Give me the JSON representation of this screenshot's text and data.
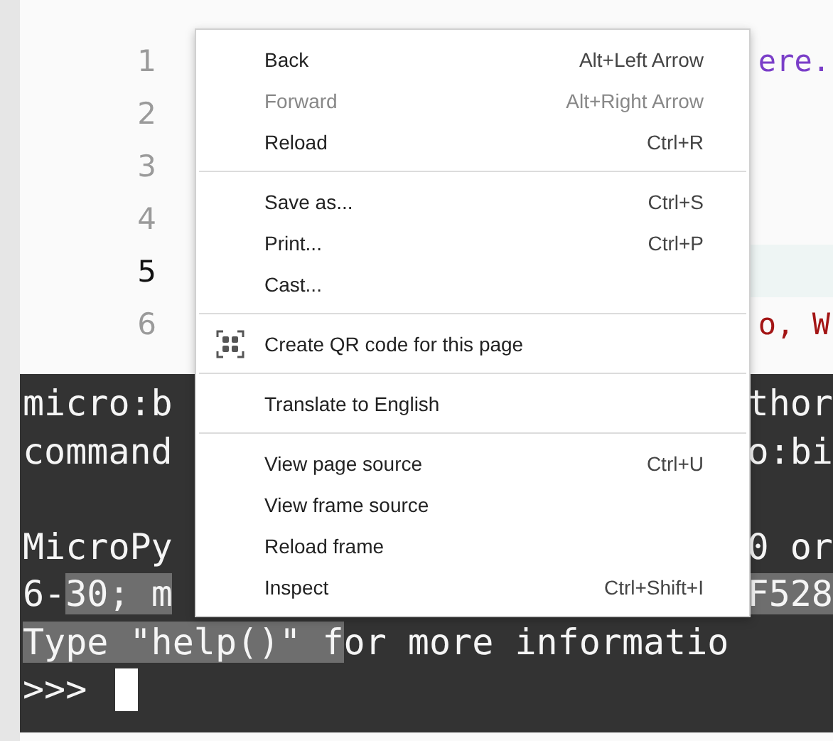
{
  "editor": {
    "lines": [
      {
        "number": "1",
        "current": false,
        "code": "ere.",
        "color": "#7a3ec8"
      },
      {
        "number": "2",
        "current": false
      },
      {
        "number": "3",
        "current": false
      },
      {
        "number": "4",
        "current": false
      },
      {
        "number": "5",
        "current": true
      },
      {
        "number": "6",
        "current": false,
        "code": "o, W",
        "color": "#a31515"
      }
    ]
  },
  "console": {
    "lines": [
      {
        "kind": "text",
        "left": [
          {
            "text": "micro:b",
            "selected": false
          }
        ],
        "right": [
          {
            "text": "thor",
            "selected": false
          }
        ]
      },
      {
        "kind": "text",
        "left": [
          {
            "text": "command",
            "selected": false
          }
        ],
        "right": [
          {
            "text": "o:bi",
            "selected": false
          }
        ]
      },
      {
        "kind": "blank"
      },
      {
        "kind": "text",
        "left": [
          {
            "text": "MicroPy",
            "selected": false
          }
        ],
        "right": [
          {
            "text": "0 or",
            "selected": false
          }
        ]
      },
      {
        "kind": "text",
        "left": [
          {
            "text": "6-",
            "selected": false
          },
          {
            "text": "30; m",
            "selected": true
          }
        ],
        "right": [
          {
            "text": "F528",
            "selected": true
          }
        ]
      },
      {
        "kind": "text",
        "left": [
          {
            "text": "Type \"help()\" f",
            "selected": true
          },
          {
            "text": "or more informatio",
            "selected": false
          }
        ]
      }
    ],
    "prompt": ">>>"
  },
  "context_menu": {
    "groups": [
      [
        {
          "label": "Back",
          "shortcut": "Alt+Left Arrow",
          "disabled": false,
          "kind": "plain"
        },
        {
          "label": "Forward",
          "shortcut": "Alt+Right Arrow",
          "disabled": true,
          "kind": "plain"
        },
        {
          "label": "Reload",
          "shortcut": "Ctrl+R",
          "disabled": false,
          "kind": "plain"
        }
      ],
      [
        {
          "label": "Save as...",
          "shortcut": "Ctrl+S",
          "disabled": false,
          "kind": "plain"
        },
        {
          "label": "Print...",
          "shortcut": "Ctrl+P",
          "disabled": false,
          "kind": "plain"
        },
        {
          "label": "Cast...",
          "disabled": false,
          "kind": "plain"
        }
      ],
      [
        {
          "label": "Create QR code for this page",
          "disabled": false,
          "kind": "qr"
        }
      ],
      [
        {
          "label": "Translate to English",
          "disabled": false,
          "kind": "plain"
        }
      ],
      [
        {
          "label": "View page source",
          "shortcut": "Ctrl+U",
          "disabled": false,
          "kind": "plain"
        },
        {
          "label": "View frame source",
          "disabled": false,
          "kind": "plain"
        },
        {
          "label": "Reload frame",
          "disabled": false,
          "kind": "plain"
        },
        {
          "label": "Inspect",
          "shortcut": "Ctrl+Shift+I",
          "disabled": false,
          "kind": "plain"
        }
      ]
    ]
  }
}
